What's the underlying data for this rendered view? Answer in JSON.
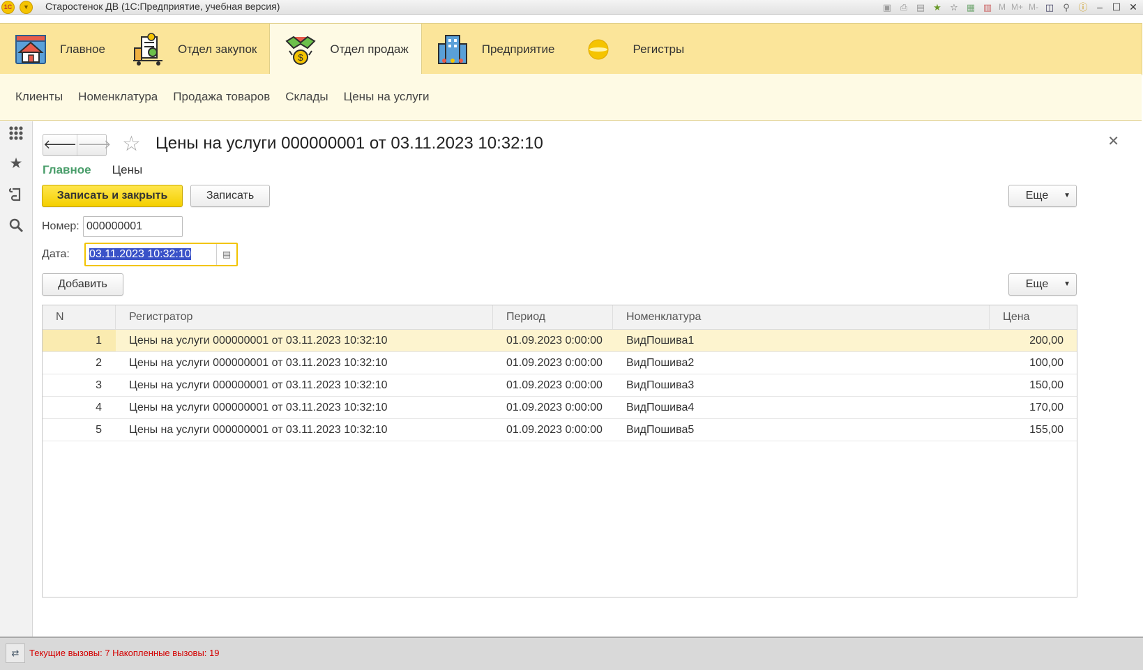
{
  "window": {
    "title": "Старостенок ДВ  (1С:Предприятие, учебная версия)",
    "toolbar_text": [
      "M",
      "M+",
      "M-"
    ]
  },
  "sections": [
    {
      "label": "Главное",
      "icon": "home-icon"
    },
    {
      "label": "Отдел закупок",
      "icon": "cart-icon"
    },
    {
      "label": "Отдел продаж",
      "icon": "handshake-money-icon",
      "active": true
    },
    {
      "label": "Предприятие",
      "icon": "building-icon"
    },
    {
      "label": "Регистры",
      "icon": "disc-icon"
    }
  ],
  "subnav": [
    "Клиенты",
    "Номенклатура",
    "Продажа товаров",
    "Склады",
    "Цены на услуги"
  ],
  "document": {
    "title": "Цены на услуги 000000001 от 03.11.2023 10:32:10",
    "tabs": {
      "main": "Главное",
      "prices": "Цены"
    },
    "buttons": {
      "save_close": "Записать и закрыть",
      "save": "Записать",
      "more": "Еще",
      "add": "Добавить"
    },
    "fields": {
      "number_label": "Номер:",
      "number_value": "000000001",
      "date_label": "Дата:",
      "date_value": "03.11.2023 10:32:10"
    }
  },
  "table": {
    "columns": [
      "N",
      "Регистратор",
      "Период",
      "Номенклатура",
      "Цена"
    ],
    "rows": [
      {
        "n": "1",
        "registrar": "Цены на услуги 000000001 от 03.11.2023 10:32:10",
        "period": "01.09.2023 0:00:00",
        "item": "ВидПошива1",
        "price": "200,00"
      },
      {
        "n": "2",
        "registrar": "Цены на услуги 000000001 от 03.11.2023 10:32:10",
        "period": "01.09.2023 0:00:00",
        "item": "ВидПошива2",
        "price": "100,00"
      },
      {
        "n": "3",
        "registrar": "Цены на услуги 000000001 от 03.11.2023 10:32:10",
        "period": "01.09.2023 0:00:00",
        "item": "ВидПошива3",
        "price": "150,00"
      },
      {
        "n": "4",
        "registrar": "Цены на услуги 000000001 от 03.11.2023 10:32:10",
        "period": "01.09.2023 0:00:00",
        "item": "ВидПошива4",
        "price": "170,00"
      },
      {
        "n": "5",
        "registrar": "Цены на услуги 000000001 от 03.11.2023 10:32:10",
        "period": "01.09.2023 0:00:00",
        "item": "ВидПошива5",
        "price": "155,00"
      }
    ]
  },
  "status": {
    "text": "Текущие вызовы: 7  Накопленные вызовы: 19"
  },
  "colors": {
    "section_bar": "#fbe59a",
    "accent_button": "#f4cf00",
    "tab_active": "#4a9e6b",
    "status_text": "#d40000"
  }
}
